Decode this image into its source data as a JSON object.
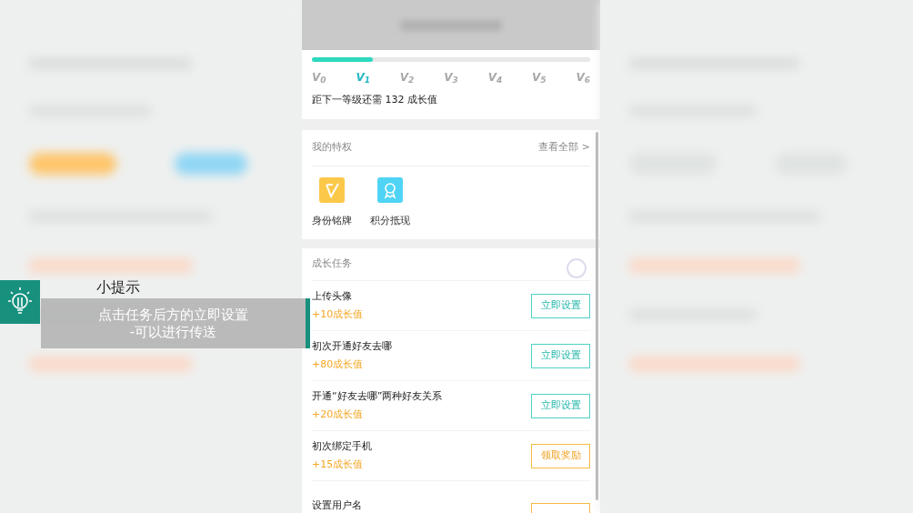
{
  "growth": {
    "level": 0.22,
    "levels": [
      {
        "label": "V$_{0}$",
        "selected": false
      },
      {
        "label": "V$_{1}$",
        "selected": true
      },
      {
        "label": "V$_{2}$",
        "selected": false
      },
      {
        "label": "V$_{3}$",
        "selected": false
      },
      {
        "label": "V$_{4}$",
        "selected": false
      },
      {
        "label": "V$_{5}$",
        "selected": false
      },
      {
        "label": "V$_{6}$",
        "selected": false
      }
    ],
    "next_level_text": "距下一等级还需 132 成长值"
  },
  "privileges": {
    "title": "我的特权",
    "view_all": "查看全部 >",
    "items": [
      {
        "label": "身份铭牌",
        "kind": "badge"
      },
      {
        "label": "积分抵现",
        "kind": "medal"
      }
    ]
  },
  "tasks": {
    "title": "成长任务",
    "items": [
      {
        "title": "上传头像",
        "points": "+10成长值",
        "button": {
          "kind": "set",
          "label": "立即设置"
        }
      },
      {
        "title": "初次开通好友去哪",
        "points": "+80成长值",
        "button": {
          "kind": "set",
          "label": "立即设置"
        }
      },
      {
        "title": "开通“好友去哪”两种好友关系",
        "points": "+20成长值",
        "button": {
          "kind": "set",
          "label": "立即设置"
        }
      },
      {
        "title": "初次绑定手机",
        "points": "+15成长值",
        "button": {
          "kind": "claim",
          "label": "领取奖励"
        }
      },
      {
        "title": "设置用户名",
        "button": {
          "kind": "claim"
        }
      }
    ]
  },
  "tip": {
    "title": "小提示",
    "lines": [
      "点击任务后方的立即设置",
      "-可以进行传送"
    ]
  }
}
